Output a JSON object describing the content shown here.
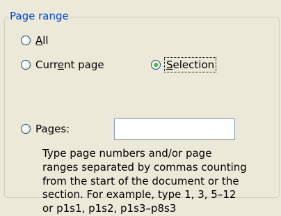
{
  "group": {
    "title": "Page range"
  },
  "options": {
    "all": {
      "prefix": "",
      "mnemonic": "A",
      "suffix": "ll",
      "selected": false
    },
    "current": {
      "prefix": "Curr",
      "mnemonic": "e",
      "suffix": "nt page",
      "selected": false
    },
    "selection": {
      "prefix": "",
      "mnemonic": "S",
      "suffix": "election",
      "selected": true
    },
    "pages": {
      "prefix": "Pa",
      "mnemonic": "g",
      "suffix": "es:",
      "selected": false
    }
  },
  "pages_input": {
    "value": ""
  },
  "hint": {
    "lines": [
      "Type page numbers and/or page",
      "ranges separated by commas counting",
      "from the start of the document or the",
      "section. For example, type 1, 3, 5–12",
      "or p1s1, p1s2, p1s3–p8s3"
    ]
  },
  "colors": {
    "background": "#ECE9D8",
    "group_title": "#0046D5",
    "group_border": "#D0D0BF",
    "input_border": "#7F9DB9",
    "radio_border": "#1C5180",
    "radio_dot": "#21A121"
  },
  "icons": {
    "radio": "radio-button"
  }
}
